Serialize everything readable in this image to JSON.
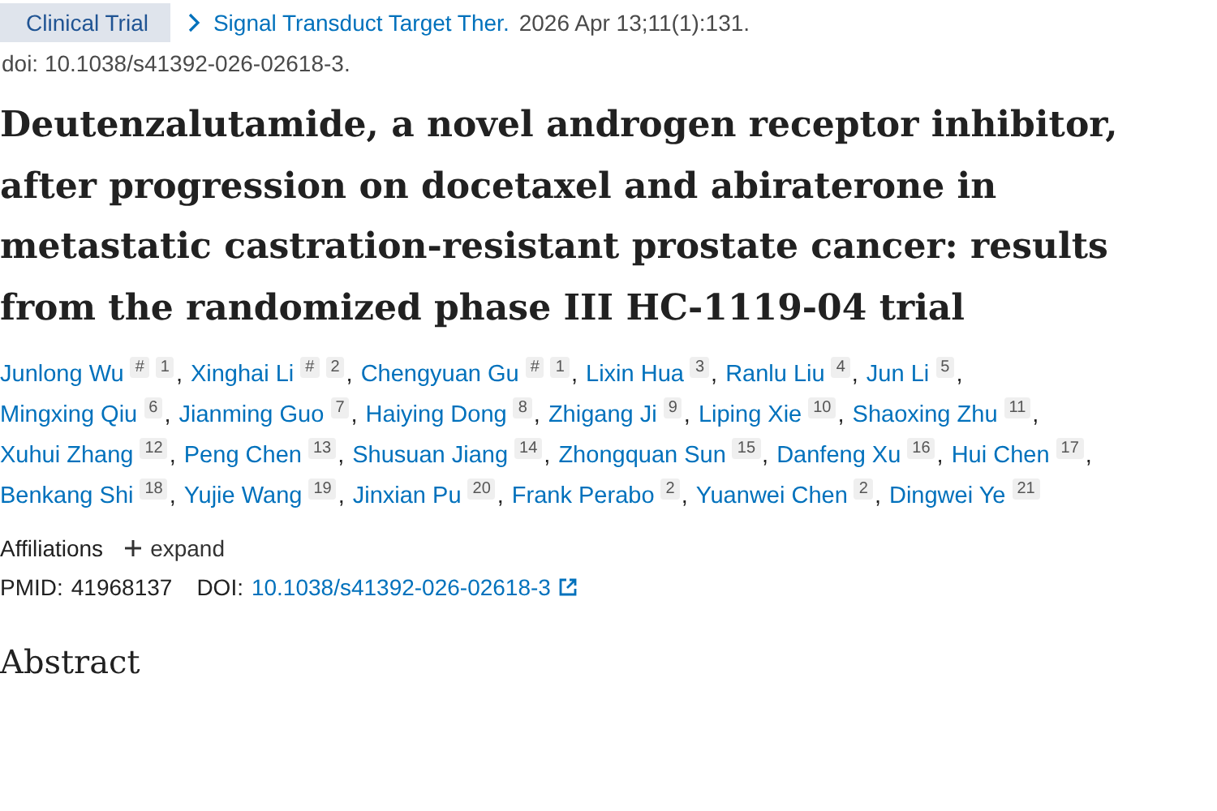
{
  "article_type": "Clinical Trial",
  "journal": {
    "name": "Signal Transduct Target Ther.",
    "citation": "2026 Apr 13;11(1):131."
  },
  "doi_line": "doi: 10.1038/s41392-026-02618-3.",
  "title": "Deutenzalutamide, a novel androgen receptor inhibitor, after progression on docetaxel and abiraterone in metastatic castration-resistant prostate cancer: results from the randomized phase III HC-1119-04 trial",
  "authors": [
    {
      "name": "Junlong Wu",
      "marks": [
        "#",
        "1"
      ]
    },
    {
      "name": "Xinghai Li",
      "marks": [
        "#",
        "2"
      ]
    },
    {
      "name": "Chengyuan Gu",
      "marks": [
        "#",
        "1"
      ]
    },
    {
      "name": "Lixin Hua",
      "marks": [
        "3"
      ]
    },
    {
      "name": "Ranlu Liu",
      "marks": [
        "4"
      ]
    },
    {
      "name": "Jun Li",
      "marks": [
        "5"
      ]
    },
    {
      "name": "Mingxing Qiu",
      "marks": [
        "6"
      ]
    },
    {
      "name": "Jianming Guo",
      "marks": [
        "7"
      ]
    },
    {
      "name": "Haiying Dong",
      "marks": [
        "8"
      ]
    },
    {
      "name": "Zhigang Ji",
      "marks": [
        "9"
      ]
    },
    {
      "name": "Liping Xie",
      "marks": [
        "10"
      ]
    },
    {
      "name": "Shaoxing Zhu",
      "marks": [
        "11"
      ]
    },
    {
      "name": "Xuhui Zhang",
      "marks": [
        "12"
      ]
    },
    {
      "name": "Peng Chen",
      "marks": [
        "13"
      ]
    },
    {
      "name": "Shusuan Jiang",
      "marks": [
        "14"
      ]
    },
    {
      "name": "Zhongquan Sun",
      "marks": [
        "15"
      ]
    },
    {
      "name": "Danfeng Xu",
      "marks": [
        "16"
      ]
    },
    {
      "name": "Hui Chen",
      "marks": [
        "17"
      ]
    },
    {
      "name": "Benkang Shi",
      "marks": [
        "18"
      ]
    },
    {
      "name": "Yujie Wang",
      "marks": [
        "19"
      ]
    },
    {
      "name": "Jinxian Pu",
      "marks": [
        "20"
      ]
    },
    {
      "name": "Frank Perabo",
      "marks": [
        "2"
      ]
    },
    {
      "name": "Yuanwei Chen",
      "marks": [
        "2"
      ]
    },
    {
      "name": "Dingwei Ye",
      "marks": [
        "21"
      ]
    }
  ],
  "separator": ",",
  "affiliations": {
    "label": "Affiliations",
    "toggle": "expand",
    "expanded": false
  },
  "ids": {
    "pmid_label": "PMID:",
    "pmid": "41968137",
    "doi_label": "DOI:",
    "doi": "10.1038/s41392-026-02618-3"
  },
  "section_heading": "Abstract"
}
